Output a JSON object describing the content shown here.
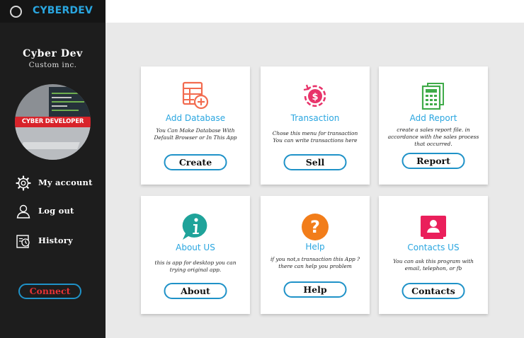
{
  "app": {
    "brand": "CYBERDEV"
  },
  "sidebar": {
    "user_name": "Cyber Dev",
    "user_sub": "Custom inc.",
    "avatar_banner": "CYBER DEVELOPER",
    "items": [
      {
        "label": "My account",
        "icon": "gear-icon"
      },
      {
        "label": "Log out",
        "icon": "user-icon"
      },
      {
        "label": "History",
        "icon": "history-icon"
      }
    ],
    "connect_label": "Connect"
  },
  "cards": [
    {
      "title": "Add Database",
      "title_color": "#2aa6e0",
      "desc": "You Can Make Database With Default Browser or In This App",
      "button": "Create",
      "icon": "database-add-icon",
      "icon_color": "#f26b4f"
    },
    {
      "title": "Transaction",
      "title_color": "#2aa6e0",
      "desc": "Chose this menu for transaction You can write transactions here",
      "button": "Sell",
      "icon": "dollar-refresh-icon",
      "icon_color": "#e8336a"
    },
    {
      "title": "Add Report",
      "title_color": "#2aa6e0",
      "desc": "create a sales report file. in accordance with the sales process that occurred.",
      "button": "Report",
      "icon": "report-sheet-icon",
      "icon_color": "#3fab49"
    },
    {
      "title": "About US",
      "title_color": "#2aa6e0",
      "desc": "this is app for desktop you can trying original app.",
      "button": "About",
      "icon": "info-bubble-icon",
      "icon_color": "#1fa39a"
    },
    {
      "title": "Help",
      "title_color": "#2aa6e0",
      "desc": "if you not,s transaction this App ? there can help you problem",
      "button": "Help",
      "icon": "question-icon",
      "icon_color": "#f27d1a"
    },
    {
      "title": "Contacts US",
      "title_color": "#2aa6e0",
      "desc": "You can ask this program with email, telephon, or fb",
      "button": "Contacts",
      "icon": "contact-card-icon",
      "icon_color": "#ea1f5b"
    }
  ]
}
